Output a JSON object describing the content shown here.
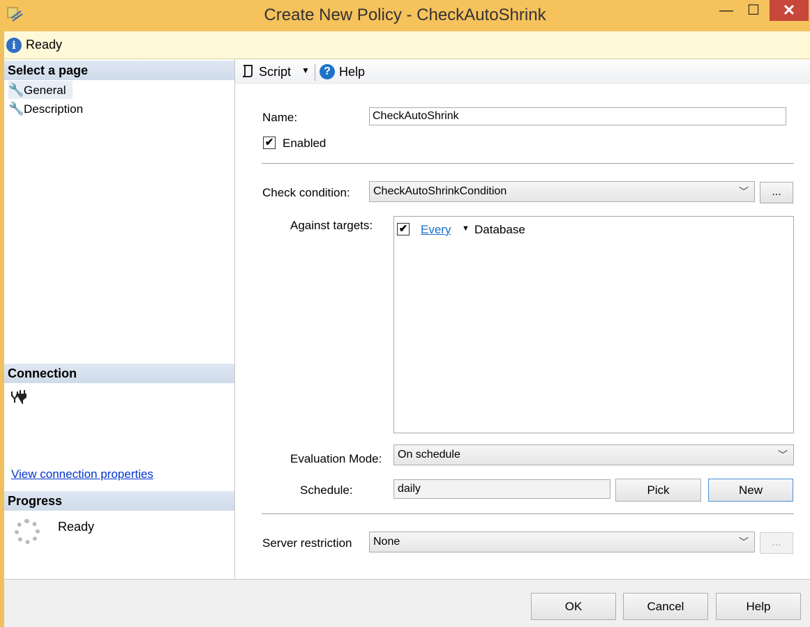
{
  "window": {
    "title": "Create New Policy - CheckAutoShrink",
    "minimize": "—",
    "maximize": "☐",
    "close": "✕"
  },
  "status": {
    "icon": "info-icon",
    "text": "Ready"
  },
  "left": {
    "select_header": "Select a page",
    "pages": [
      {
        "label": "General",
        "icon": "wrench-icon"
      },
      {
        "label": "Description",
        "icon": "wrench-icon"
      }
    ],
    "connection_header": "Connection",
    "connection_link": "View connection properties",
    "progress_header": "Progress",
    "progress_status": "Ready"
  },
  "toolbar": {
    "script_label": "Script",
    "help_label": "Help"
  },
  "form": {
    "name_label": "Name:",
    "name_value": "CheckAutoShrink",
    "enabled_label": "Enabled",
    "enabled_checked": true,
    "check_condition_label": "Check condition:",
    "check_condition_value": "CheckAutoShrinkCondition",
    "browse_label": "...",
    "against_targets_label": "Against targets:",
    "target_every": "Every",
    "target_type": "Database",
    "evaluation_mode_label": "Evaluation Mode:",
    "evaluation_mode_value": "On schedule",
    "schedule_label": "Schedule:",
    "schedule_value": "daily",
    "pick_label": "Pick",
    "new_label": "New",
    "server_restriction_label": "Server restriction",
    "server_restriction_value": "None"
  },
  "buttons": {
    "ok": "OK",
    "cancel": "Cancel",
    "help": "Help"
  }
}
